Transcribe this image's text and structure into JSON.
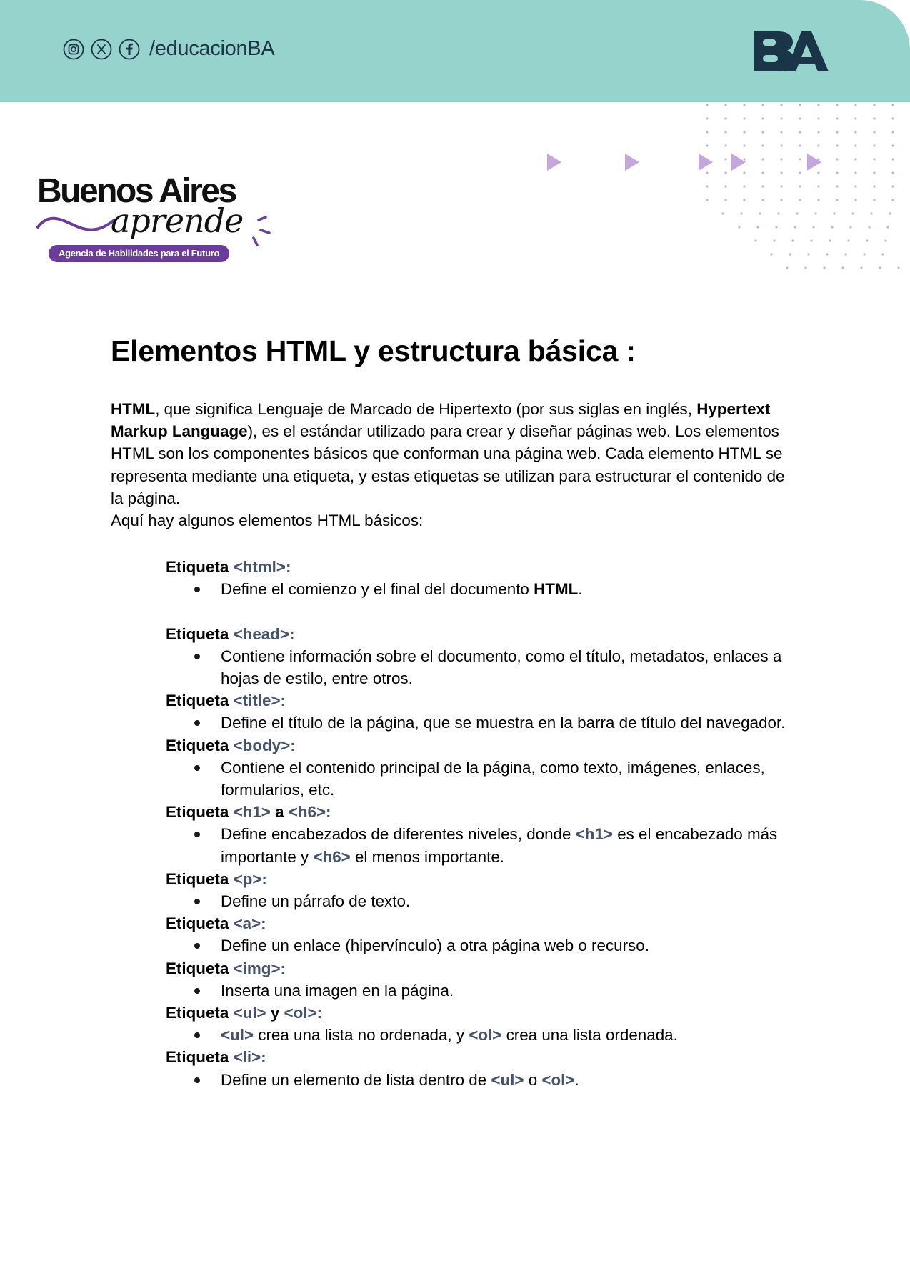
{
  "header": {
    "social_handle": "/educacionBA",
    "icons": [
      "instagram-icon",
      "x-icon",
      "facebook-icon"
    ],
    "band_color": "#96d3cd",
    "logo_text": "BA"
  },
  "brand": {
    "title": "Buenos Aires",
    "script": "aprende",
    "tagline": "Agencia de Habilidades para el Futuro",
    "accent_color": "#6a3d9c"
  },
  "document": {
    "title": "Elementos HTML y estructura básica :",
    "intro": {
      "p1_bold_1": "HTML",
      "p1_text_1": ", que significa Lenguaje de Marcado de Hipertexto (por sus siglas en inglés, ",
      "p1_bold_2": "Hypertext Markup Language",
      "p1_text_2": "), es el estándar utilizado para crear y diseñar páginas web. Los elementos HTML son los componentes básicos que conforman una página web. Cada elemento HTML se representa mediante una etiqueta, y estas etiquetas se utilizan para estructurar el contenido de la página.",
      "p2": "Aquí hay algunos elementos HTML básicos:"
    },
    "word_etiqueta": "Etiqueta ",
    "colon": ":",
    "sections": {
      "html": {
        "tag": "<html>",
        "desc": "Define el comienzo y el final del documento ",
        "desc_bold": "HTML",
        "desc_end": "."
      },
      "head": {
        "tag": "<head>",
        "desc": "Contiene información sobre el documento, como el título, metadatos, enlaces a hojas de estilo, entre otros."
      },
      "title": {
        "tag": "<title>",
        "desc": "Define el título de la página, que se muestra en la barra de título del navegador."
      },
      "body": {
        "tag": "<body>",
        "desc": "Contiene el contenido principal de la página, como texto, imágenes, enlaces, formularios, etc."
      },
      "h1h6": {
        "tag1": "<h1>",
        "joiner": " a ",
        "tag2": "<h6>",
        "desc_1": "Define encabezados de diferentes niveles, donde ",
        "code_1": "<h1>",
        "desc_2": " es el encabezado más importante y ",
        "code_2": "<h6>",
        "desc_3": " el menos importante."
      },
      "p": {
        "tag": "<p>",
        "desc": "Define un párrafo de texto."
      },
      "a": {
        "tag": "<a>",
        "desc": "Define un enlace (hipervínculo) a otra página web o recurso."
      },
      "img": {
        "tag": "<img>",
        "desc": "Inserta una imagen en la página."
      },
      "ulol": {
        "tag1": "<ul>",
        "joiner": " y ",
        "tag2": "<ol>",
        "code_1": "<ul>",
        "desc_1": " crea una lista no ordenada, y ",
        "code_2": "<ol>",
        "desc_2": " crea una lista ordenada."
      },
      "li": {
        "tag": "<li>",
        "desc_1": "Define un elemento de lista dentro de ",
        "code_1": "<ul>",
        "desc_2": " o ",
        "code_2": "<ol>",
        "desc_3": "."
      }
    },
    "code_color": "#46526a"
  }
}
